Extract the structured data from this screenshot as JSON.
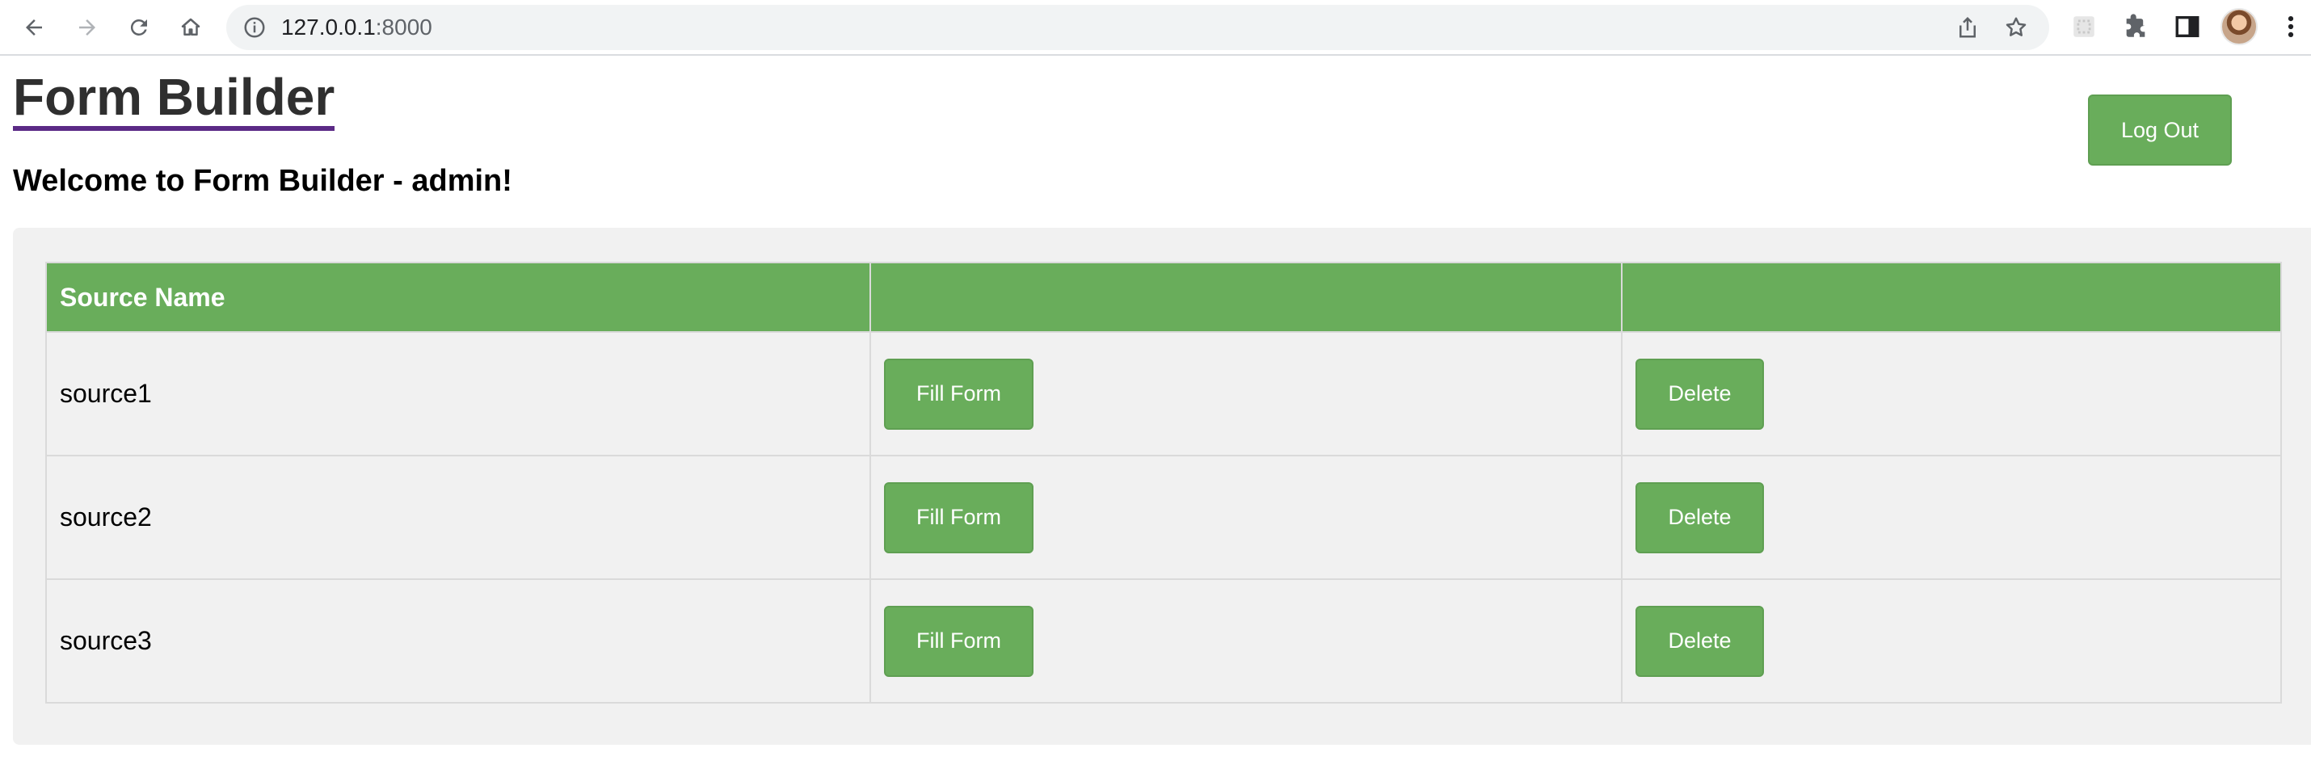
{
  "browser": {
    "url_host": "127.0.0.1",
    "url_port": ":8000",
    "icons": [
      "back-icon",
      "forward-icon",
      "reload-icon",
      "home-icon",
      "site-info-icon",
      "share-icon",
      "bookmark-star-icon",
      "extension-icon",
      "puzzle-icon",
      "side-panel-icon",
      "profile-avatar",
      "menu-dots-icon"
    ]
  },
  "page": {
    "title": "Form Builder",
    "welcome": "Welcome to Form Builder - admin!",
    "logout_label": "Log Out"
  },
  "table": {
    "headers": [
      "Source Name",
      "",
      ""
    ],
    "rows": [
      {
        "name": "source1",
        "fill_label": "Fill Form",
        "delete_label": "Delete"
      },
      {
        "name": "source2",
        "fill_label": "Fill Form",
        "delete_label": "Delete"
      },
      {
        "name": "source3",
        "fill_label": "Fill Form",
        "delete_label": "Delete"
      }
    ]
  },
  "colors": {
    "accent_green": "#69ad5b",
    "panel_bg": "#f1f1f1",
    "title_underline": "#5b2a86"
  }
}
